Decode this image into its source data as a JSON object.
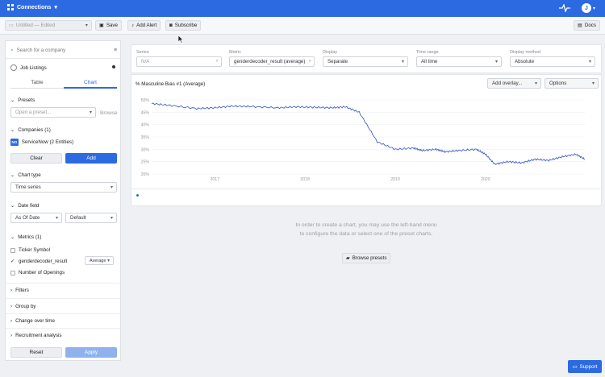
{
  "topbar": {
    "app_name": "Connections",
    "user_initial": "J"
  },
  "toolbar": {
    "untitled": "Untitled — Edited",
    "save": "Save",
    "add_alert": "Add Alert",
    "subscribe": "Subscribe",
    "docs": "Docs"
  },
  "sidebar": {
    "search_placeholder": "Search for a company",
    "dataset": "Job Listings",
    "tabs": [
      "Table",
      "Chart"
    ],
    "presets": {
      "title": "Presets",
      "placeholder": "Open a preset...",
      "browse": "Browse"
    },
    "companies": {
      "title": "Companies (1)",
      "badge": "NO",
      "name": "ServiceNow (2 Entities)",
      "clear": "Clear",
      "add": "Add"
    },
    "chart_type": {
      "title": "Chart type",
      "value": "Time series"
    },
    "date_field": {
      "title": "Date field",
      "value": "As Of Date",
      "mode": "Default"
    },
    "metrics": {
      "title": "Metrics (1)",
      "items": [
        "Ticker Symbol",
        "genderdecoder_result",
        "Number of Openings"
      ],
      "agg": "Average"
    },
    "collapsed": [
      "Filters",
      "Group by",
      "Change over time",
      "Recruitment analysis"
    ],
    "reset": "Reset",
    "apply": "Apply"
  },
  "selectors": {
    "series": {
      "label": "Series",
      "value": "N/A"
    },
    "metric": {
      "label": "Metric",
      "value": "genderdecoder_result (average)"
    },
    "display": {
      "label": "Display",
      "value": "Separate"
    },
    "time_range": {
      "label": "Time range",
      "value": "All time"
    },
    "display_method": {
      "label": "Display method",
      "value": "Absolute"
    }
  },
  "chart": {
    "title": "% Masculine Bias #1 (Average)",
    "add_overlay": "Add overlay...",
    "options": "Options"
  },
  "empty_state": {
    "line1": "In order to create a chart, you may use the left-hand menu",
    "line2": "to configure the data or select one of the preset charts.",
    "browse_presets": "Browse presets"
  },
  "support": "Support",
  "colors": {
    "brand": "#2c6ae2",
    "line": "#2f4fc4"
  },
  "chart_data": {
    "type": "line",
    "title": "% Masculine Bias #1 (Average)",
    "xlabel": "",
    "ylabel": "",
    "y_ticks": [
      "50%",
      "45%",
      "40%",
      "35%",
      "30%",
      "25%",
      "20%"
    ],
    "x_ticks": [
      "2017",
      "2018",
      "2019",
      "2020"
    ],
    "ylim": [
      20,
      50
    ],
    "xlim": [
      2016.3,
      2021.1
    ],
    "series": [
      {
        "x": [
          2016.3,
          2016.5,
          2016.8,
          2017.0,
          2017.2,
          2017.4,
          2017.7,
          2017.9,
          2018.1,
          2018.3,
          2018.45,
          2018.6,
          2018.8,
          2019.0,
          2019.2,
          2019.3,
          2019.45,
          2019.55,
          2019.7,
          2019.9,
          2020.0,
          2020.1,
          2020.25,
          2020.4,
          2020.55,
          2020.7,
          2020.85,
          2021.0,
          2021.1
        ],
        "y": [
          48.5,
          47.8,
          46.5,
          46.8,
          47.5,
          47.3,
          46.8,
          47.2,
          47.0,
          46.8,
          47.2,
          45.0,
          33.0,
          30.0,
          30.5,
          29.5,
          30.0,
          29.0,
          29.5,
          30.0,
          28.0,
          24.0,
          25.0,
          24.5,
          26.0,
          25.5,
          27.0,
          28.0,
          26.0
        ]
      }
    ]
  }
}
